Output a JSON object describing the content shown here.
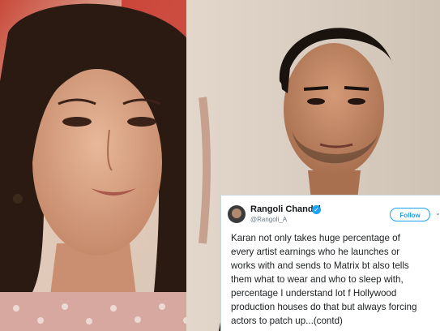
{
  "tweet": {
    "author_name": "Rangoli Chandel",
    "handle": "@Rangoli_A",
    "follow_label": "Follow",
    "text_lines": [
      "Karan not only takes huge percentage of",
      "every artist earnings who he launches or",
      "works with and sends to Matrix bt also tells",
      "them what to wear and who to sleep with,",
      "percentage I understand lot f Hollywood",
      "production houses do that but always forcing",
      "actors to patch up...(contd)"
    ]
  },
  "icons": {
    "verified": "verified-badge-icon",
    "menu": "chevron-down-icon"
  },
  "colors": {
    "twitter_blue": "#1da1f2",
    "text_dark": "#14171a",
    "text_muted": "#657786"
  }
}
